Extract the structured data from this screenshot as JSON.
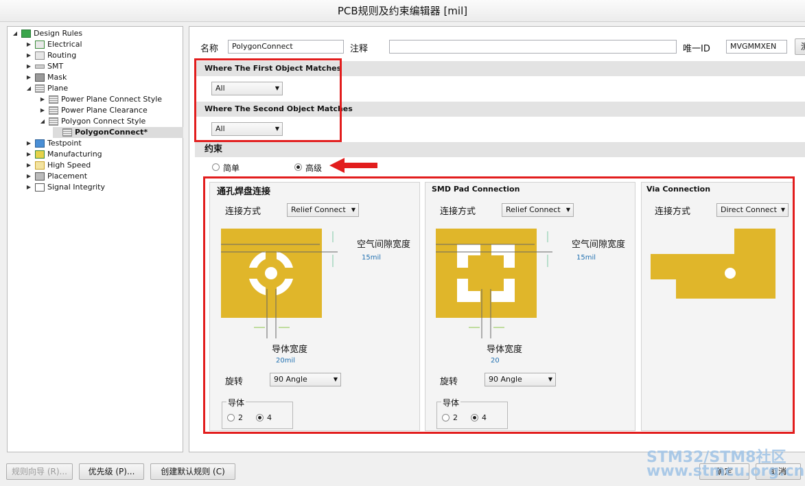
{
  "window": {
    "title": "PCB规则及约束编辑器 [mil]"
  },
  "tree": [
    {
      "label": "Design Rules",
      "twisty": "◢"
    },
    {
      "label": "Electrical",
      "twisty": "▶"
    },
    {
      "label": "Routing",
      "twisty": "▶"
    },
    {
      "label": "SMT",
      "twisty": "▶"
    },
    {
      "label": "Mask",
      "twisty": "▶"
    },
    {
      "label": "Plane",
      "twisty": "◢"
    },
    {
      "label": "Power Plane Connect Style",
      "twisty": "▶"
    },
    {
      "label": "Power Plane Clearance",
      "twisty": "▶"
    },
    {
      "label": "Polygon Connect Style",
      "twisty": "◢"
    },
    {
      "label": "PolygonConnect*",
      "twisty": ""
    },
    {
      "label": "Testpoint",
      "twisty": "▶"
    },
    {
      "label": "Manufacturing",
      "twisty": "▶"
    },
    {
      "label": "High Speed",
      "twisty": "▶"
    },
    {
      "label": "Placement",
      "twisty": "▶"
    },
    {
      "label": "Signal Integrity",
      "twisty": "▶"
    }
  ],
  "header": {
    "name_label": "名称",
    "name_value": "PolygonConnect",
    "comment_label": "注释",
    "comment_value": "",
    "id_label": "唯一ID",
    "id_value": "MVGMMXEN",
    "test_button_label": "测"
  },
  "first_match": {
    "title": "Where The First Object Matches",
    "value": "All"
  },
  "second_match": {
    "title": "Where The Second Object Matches",
    "value": "All"
  },
  "constraints": {
    "title": "约束",
    "simple_label": "简单",
    "advanced_label": "高级",
    "selected": "advanced"
  },
  "through_hole": {
    "title": "通孔焊盘连接",
    "conn_label": "连接方式",
    "conn_value": "Relief Connect",
    "air_gap_label": "空气间隙宽度",
    "air_gap_value": "15mil",
    "conductor_width_label": "导体宽度",
    "conductor_width_value": "20mil",
    "rotation_label": "旋转",
    "rotation_value": "90 Angle",
    "conductors_label": "导体",
    "opt_2": "2",
    "opt_4": "4"
  },
  "smd_pad": {
    "title": "SMD Pad Connection",
    "conn_label": "连接方式",
    "conn_value": "Relief Connect",
    "air_gap_label": "空气间隙宽度",
    "air_gap_value": "15mil",
    "conductor_width_label": "导体宽度",
    "conductor_width_value": "20",
    "rotation_label": "旋转",
    "rotation_value": "90 Angle",
    "conductors_label": "导体",
    "opt_2": "2",
    "opt_4": "4"
  },
  "via": {
    "title": "Via Connection",
    "conn_label": "连接方式",
    "conn_value": "Direct Connect"
  },
  "footer": {
    "wizard_label": "规则向导 (R)...",
    "priority_label": "优先级 (P)...",
    "create_default_label": "创建默认规则 (C)",
    "ok_label": "确定",
    "cancel_label": "取消"
  },
  "watermark": {
    "line1": "STM32/STM8社区",
    "line2": "www.stmcu.org.cn"
  },
  "colors": {
    "copper": "#e0b62a",
    "annotation": "#e21d1d",
    "link": "#1f6fb0"
  }
}
